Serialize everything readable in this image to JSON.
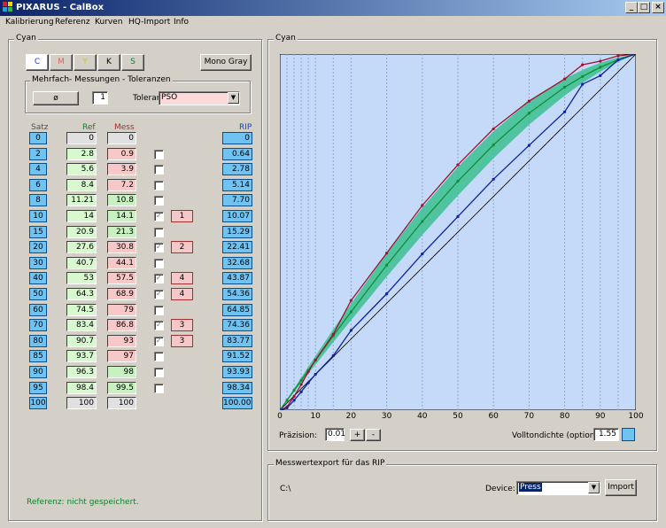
{
  "window": {
    "title": "PIXARUS - CalBox",
    "btn_min": "_",
    "btn_max": "□",
    "btn_close": "×"
  },
  "menu": [
    "Kalibrierung",
    "Referenz",
    "Kurven",
    "HQ-Import",
    "Info"
  ],
  "left": {
    "group_title": "Cyan",
    "channels": [
      "C",
      "M",
      "Y",
      "K",
      "S"
    ],
    "mono_gray": "Mono Gray",
    "meas_group_title": "Mehrfach- Messungen - Toleranzen",
    "avg_symbol": "ø",
    "count": "1",
    "tol_label": "Toleranz:",
    "tol_value": "PSO",
    "headers": {
      "satz": "Satz",
      "ref": "Ref",
      "mess": "Mess",
      "rip": "RIP"
    },
    "rows": [
      {
        "satz": "0",
        "ref": "0",
        "mess": "0",
        "check": "",
        "num": "",
        "rip": "0"
      },
      {
        "satz": "2",
        "ref": "2.8",
        "mess": "0.9",
        "check": "",
        "num": "",
        "rip": "0.64"
      },
      {
        "satz": "4",
        "ref": "5.6",
        "mess": "3.9",
        "check": "",
        "num": "",
        "rip": "2.78"
      },
      {
        "satz": "6",
        "ref": "8.4",
        "mess": "7.2",
        "check": "",
        "num": "",
        "rip": "5.14"
      },
      {
        "satz": "8",
        "ref": "11.21",
        "mess": "10.8",
        "check": "",
        "num": "",
        "rip": "7.70"
      },
      {
        "satz": "10",
        "ref": "14",
        "mess": "14.1",
        "check": "✓",
        "num": "1",
        "rip": "10.07"
      },
      {
        "satz": "15",
        "ref": "20.9",
        "mess": "21.3",
        "check": "",
        "num": "",
        "rip": "15.29"
      },
      {
        "satz": "20",
        "ref": "27.6",
        "mess": "30.8",
        "check": "✓",
        "num": "2",
        "rip": "22.41"
      },
      {
        "satz": "30",
        "ref": "40.7",
        "mess": "44.1",
        "check": "",
        "num": "",
        "rip": "32.68"
      },
      {
        "satz": "40",
        "ref": "53",
        "mess": "57.5",
        "check": "✓",
        "num": "4",
        "rip": "43.87"
      },
      {
        "satz": "50",
        "ref": "64.3",
        "mess": "68.9",
        "check": "✓",
        "num": "4",
        "rip": "54.36"
      },
      {
        "satz": "60",
        "ref": "74.5",
        "mess": "79",
        "check": "",
        "num": "",
        "rip": "64.85"
      },
      {
        "satz": "70",
        "ref": "83.4",
        "mess": "86.8",
        "check": "✓",
        "num": "3",
        "rip": "74.36"
      },
      {
        "satz": "80",
        "ref": "90.7",
        "mess": "93",
        "check": "✓",
        "num": "3",
        "rip": "83.77"
      },
      {
        "satz": "85",
        "ref": "93.7",
        "mess": "97",
        "check": "",
        "num": "",
        "rip": "91.52"
      },
      {
        "satz": "90",
        "ref": "96.3",
        "mess": "98",
        "check": "",
        "num": "",
        "rip": "93.93"
      },
      {
        "satz": "95",
        "ref": "98.4",
        "mess": "99.5",
        "check": "",
        "num": "",
        "rip": "98.34"
      },
      {
        "satz": "100",
        "ref": "100",
        "mess": "100",
        "check": "",
        "num": "",
        "rip": "100.00"
      }
    ],
    "status": "Referenz: nicht gespeichert."
  },
  "right": {
    "group_title": "Cyan",
    "precision_label": "Präzision:",
    "precision_value": "0.01",
    "plus": "+",
    "minus": "-",
    "density_label": "Volltondichte (optional)",
    "density_value": "1.55"
  },
  "export": {
    "group_title": "Messwertexport für das RIP",
    "path": "C:\\",
    "device_label": "Device:",
    "device_value": "Press",
    "import_button": "Import"
  },
  "colors": {
    "accent": "#0a246a",
    "rip": "#6ec3f2",
    "ref": "#d8f8d0",
    "mess_red": "#f8c8c8",
    "mess_green": "#c8f0c0",
    "plot_bg": "#c4daf8",
    "band": "#3cc090",
    "ref_line": "#109030",
    "mess_line": "#a01030",
    "rip_line": "#1020a0"
  },
  "chart_data": {
    "type": "line",
    "x": [
      0,
      2,
      4,
      6,
      8,
      10,
      15,
      20,
      30,
      40,
      50,
      60,
      70,
      80,
      85,
      90,
      95,
      100
    ],
    "xlim": [
      0,
      100
    ],
    "ylim": [
      0,
      100
    ],
    "xticks": [
      "0",
      "10",
      "20",
      "30",
      "40",
      "50",
      "60",
      "70",
      "80",
      "90",
      "100"
    ],
    "series": [
      {
        "values": [
          0,
          2.8,
          5.6,
          8.4,
          11.21,
          14,
          20.9,
          27.6,
          40.7,
          53,
          64.3,
          74.5,
          83.4,
          90.7,
          93.7,
          96.3,
          98.4,
          100
        ]
      },
      {
        "values": [
          0,
          0.9,
          3.9,
          7.2,
          10.8,
          14.1,
          21.3,
          30.8,
          44.1,
          57.5,
          68.9,
          79,
          86.8,
          93,
          97,
          98,
          99.5,
          100
        ]
      },
      {
        "values": [
          0,
          0.64,
          2.78,
          5.14,
          7.7,
          10.07,
          15.29,
          22.41,
          32.68,
          43.87,
          54.36,
          64.85,
          74.36,
          83.77,
          91.52,
          93.93,
          98.34,
          100
        ]
      }
    ],
    "band_tolerance": 4,
    "diagonal": true
  }
}
